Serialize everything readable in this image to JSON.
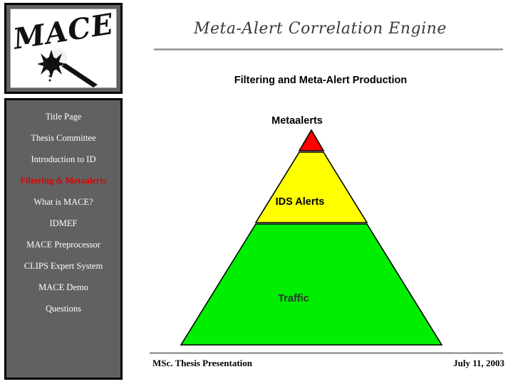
{
  "logo": {
    "wordmark": "MACE",
    "alt_name": "mace-weapon-graphic"
  },
  "header": {
    "title": "Meta-Alert Correlation Engine",
    "subtitle": "Filtering and Meta-Alert Production"
  },
  "sidebar": {
    "items": [
      {
        "label": "Title Page",
        "active": false
      },
      {
        "label": "Thesis Committee",
        "active": false
      },
      {
        "label": "Introduction to ID",
        "active": false
      },
      {
        "label": "Filtering & Metaalerts",
        "active": true
      },
      {
        "label": "What is MACE?",
        "active": false
      },
      {
        "label": "IDMEF",
        "active": false
      },
      {
        "label": "MACE Preprocessor",
        "active": false
      },
      {
        "label": "CLIPS Expert System",
        "active": false
      },
      {
        "label": "MACE Demo",
        "active": false
      },
      {
        "label": "Questions",
        "active": false
      }
    ],
    "background_color": "#616161",
    "text_color": "#ffffff",
    "active_color": "#e00000"
  },
  "diagram": {
    "type": "pyramid",
    "layers": [
      {
        "label": "Metaalerts",
        "color": "#ff0000",
        "position": "top"
      },
      {
        "label": "IDS Alerts",
        "color": "#ffff00",
        "position": "middle"
      },
      {
        "label": "Traffic",
        "color": "#00ee00",
        "position": "base"
      }
    ]
  },
  "footer": {
    "left": "MSc. Thesis Presentation",
    "right": "July 11, 2003"
  }
}
